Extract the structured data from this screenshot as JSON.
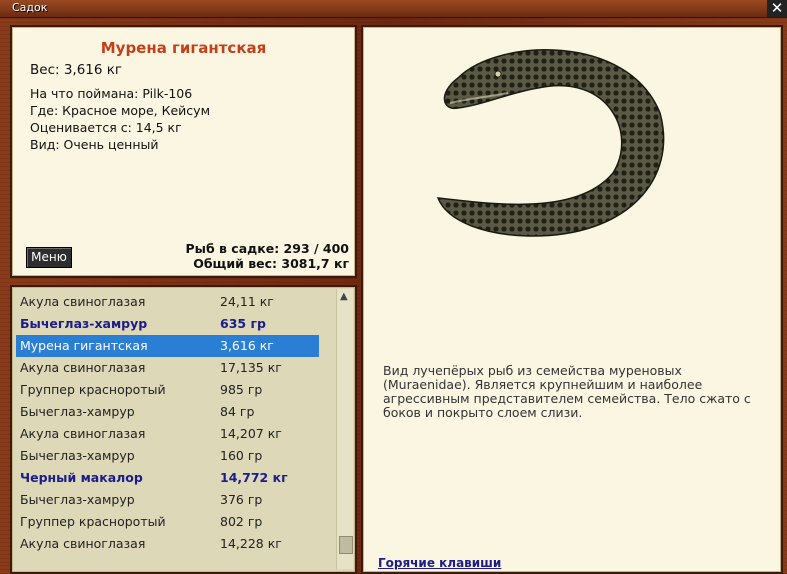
{
  "window": {
    "title": "Садок",
    "close_glyph": "✕"
  },
  "fish": {
    "name": "Мурена гигантская",
    "weight": "Вес: 3,616 кг",
    "bait": "На что поймана: Pilk-106",
    "location": "Где: Красное море, Кейсум",
    "value": "Оценивается с: 14,5 кг",
    "kind": "Вид: Очень ценный",
    "description": "Вид лучепёрых рыб из семейства мурeновых (Muraenidae). Является крупнейшим и наиболее агрессивным представителем семейства. Тело сжато с боков и покрыто слоем слизи."
  },
  "menu_button": "Меню",
  "stats": {
    "count": "Рыб в садке: 293 / 400",
    "total": "Общий вес: 3081,7 кг"
  },
  "list": [
    {
      "name": "Акула свиноглазая",
      "weight": "24,11 кг"
    },
    {
      "name": "Бычеглаз-хамрур",
      "weight": "635 гр",
      "bold": true
    },
    {
      "name": "Мурена гигантская",
      "weight": "3,616 кг",
      "selected": true
    },
    {
      "name": "Акула свиноглазая",
      "weight": "17,135 кг"
    },
    {
      "name": "Группер краснорoтый",
      "weight": "985 гр"
    },
    {
      "name": "Бычеглаз-хамрур",
      "weight": "84 гр"
    },
    {
      "name": "Акула свиноглазая",
      "weight": "14,207 кг"
    },
    {
      "name": "Бычеглаз-хамрур",
      "weight": "160 гр"
    },
    {
      "name": "Черный макалор",
      "weight": "14,772 кг",
      "bold": true
    },
    {
      "name": "Бычеглаз-хамрур",
      "weight": "376 гр"
    },
    {
      "name": "Группер краснорoтый",
      "weight": "802 гр"
    },
    {
      "name": "Акула свиноглазая",
      "weight": "14,228 кг"
    }
  ],
  "hotkeys": "Горячие клавиши",
  "colors": {
    "selection": "#2a7fd4",
    "accent_name": "#c2401a",
    "bold_rows": "#1c1c8a"
  }
}
